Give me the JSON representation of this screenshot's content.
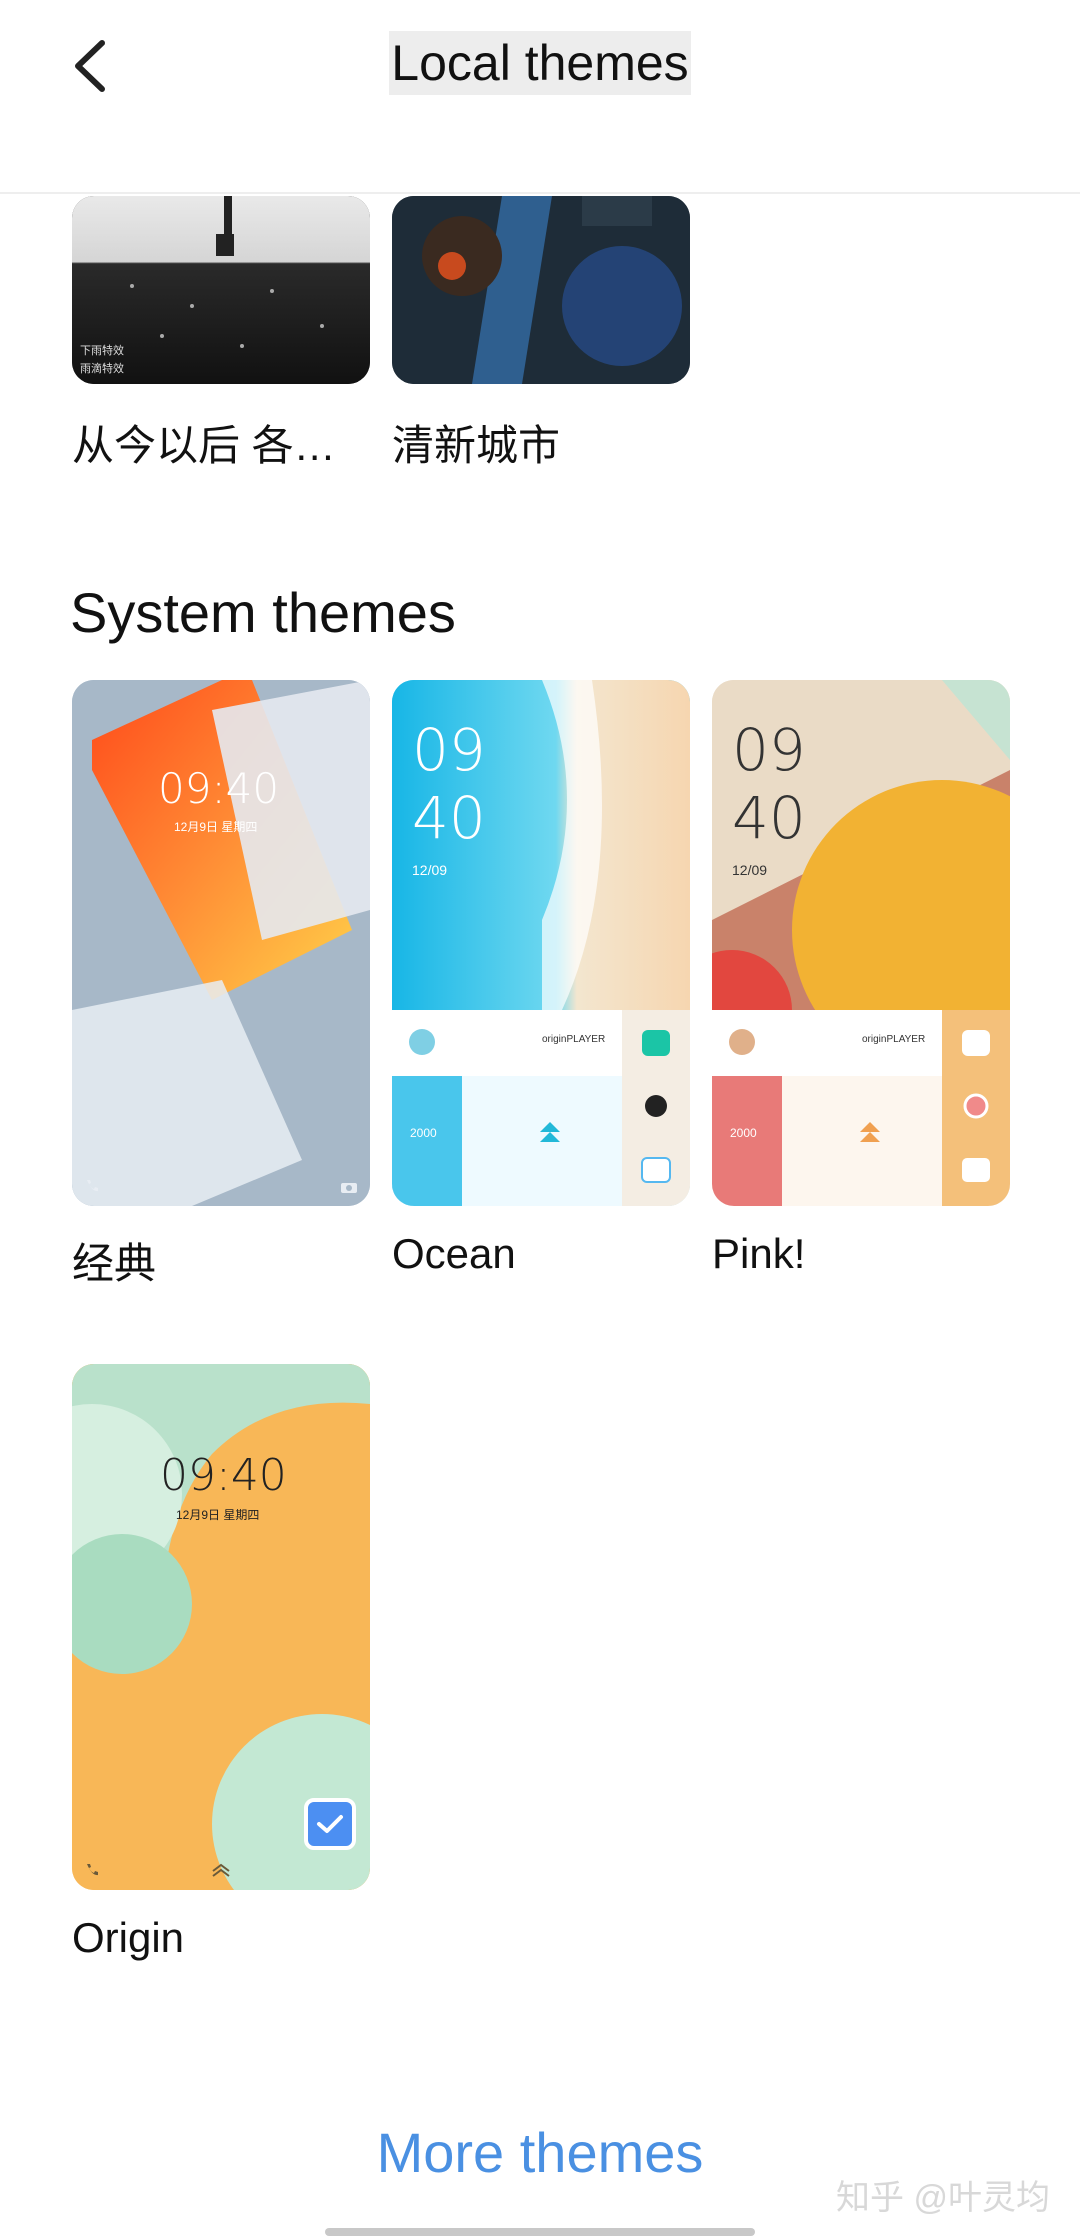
{
  "header": {
    "title": "Local themes",
    "back_icon": "chevron-left-icon"
  },
  "local_themes": [
    {
      "name": "从今以后 各…",
      "lines": [
        "下雨特效",
        "雨滴特效"
      ]
    },
    {
      "name": "清新城市"
    }
  ],
  "system_section": {
    "title": "System themes",
    "themes": [
      {
        "name": "经典",
        "time": "09:40",
        "date": "12月9日 星期四"
      },
      {
        "name": "Ocean",
        "hour": "09",
        "minute": "40",
        "date": "12/09",
        "brand": "originPLAYER",
        "steps": "2000"
      },
      {
        "name": "Pink!",
        "hour": "09",
        "minute": "40",
        "date": "12/09",
        "brand": "originPLAYER",
        "steps": "2000"
      },
      {
        "name": "Origin",
        "time": "09:40",
        "date": "12月9日  星期四",
        "selected": true
      }
    ]
  },
  "footer": {
    "more_label": "More themes",
    "watermark": "知乎 @叶灵均"
  },
  "colors": {
    "accent": "#4a90e2",
    "check": "#4c8ff2"
  }
}
